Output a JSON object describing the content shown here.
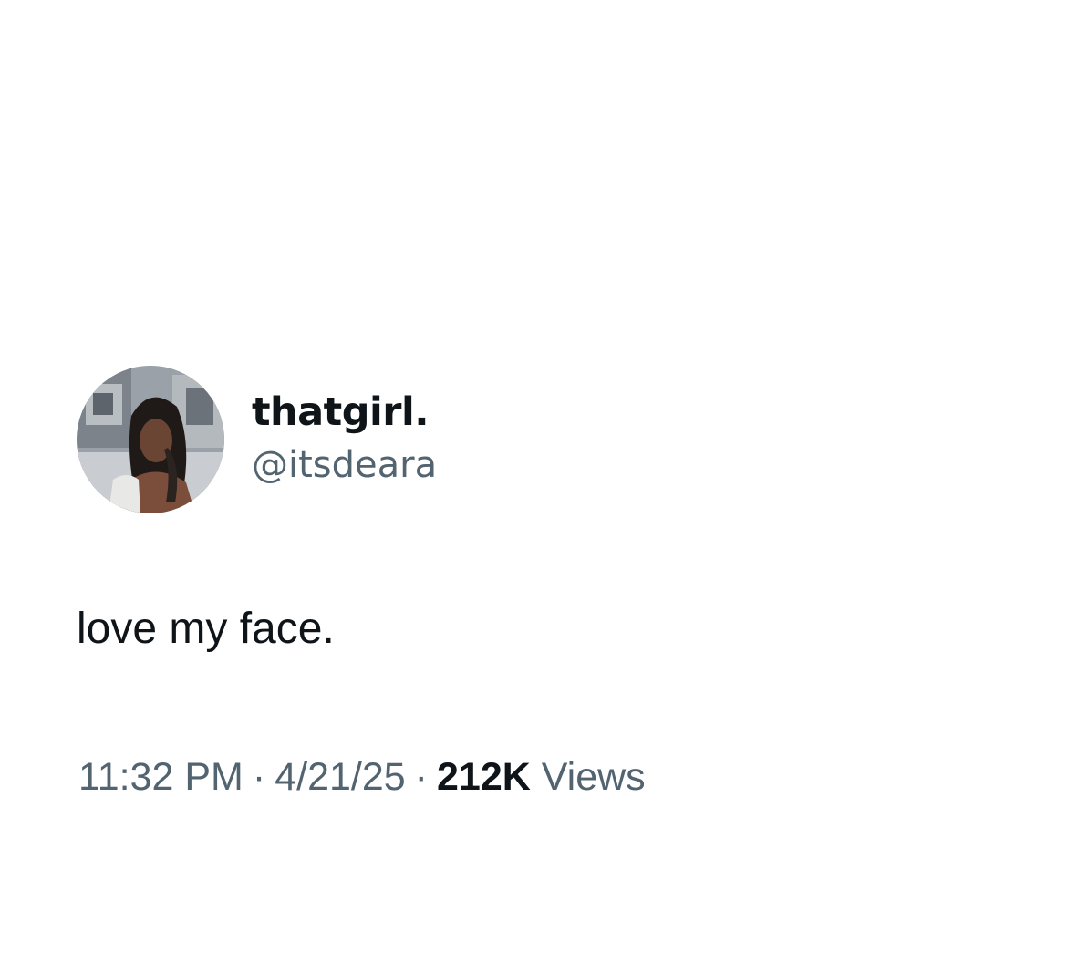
{
  "tweet": {
    "display_name": "thatgirl.",
    "handle": "@itsdeara",
    "text": "love my face.",
    "time": "11:32 PM",
    "date": "4/21/25",
    "separator": "·",
    "views_count": "212K",
    "views_label": "Views"
  }
}
